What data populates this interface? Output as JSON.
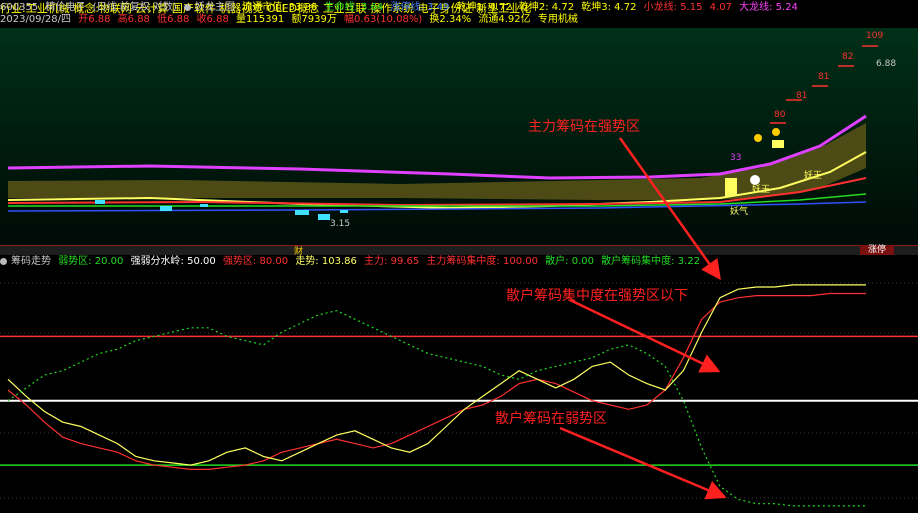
{
  "header": {
    "code": "600355",
    "name": "精伦电子",
    "period": "(日线 前复权 对数)",
    "main_label": "妖龙主图",
    "float_value": "流通市值: 33.86",
    "life_line": "生命线: 3.64",
    "cumulative": "涨停线: 3.49",
    "qk1": "乾坤1: 4.72",
    "qk2": "乾坤2: 4.72",
    "qk3": "乾坤3: 4.72",
    "small_dragon": "小龙线: 5.15",
    "mid": "4.07",
    "big_dragon": "大龙线: 5.24"
  },
  "quote": {
    "date": "2023/09/28/四",
    "open": "开6.88",
    "high": "高6.88",
    "low": "低6.88",
    "close": "收6.88",
    "volume": "量115391",
    "amount": "额7939万",
    "change": "幅0.63(10.08%)",
    "turnover": "换2.34%",
    "float": "流通4.92亿",
    "industry": "专用机械"
  },
  "concepts": "行业:工业机械 概念:物联网 云计算 国产软件 机器视觉 OLED概念 工业互联 操作系统 电子身份证 新型工业化",
  "upper_chart": {
    "price_labels": [
      "109",
      "82",
      "81",
      "81",
      "80"
    ],
    "last_price": "6.88",
    "low_price": "3.15",
    "bottom_label": "妖气",
    "text_wang": "妖王",
    "text_jingwang": "妖王",
    "text_33": "33",
    "fin_mark": "财",
    "zt_badge": "涨停"
  },
  "indicator": {
    "name": "筹码走势",
    "weak": "弱势区: 20.00",
    "divide": "强弱分水岭: 50.00",
    "strong": "强势区: 80.00",
    "trend": "走势: 103.86",
    "main": "主力: 99.65",
    "main_conc": "主力筹码集中度: 100.00",
    "retail": "散户: 0.00",
    "retail_conc": "散户筹码集中度: 3.22"
  },
  "annotations": {
    "a1": "主力筹码在强势区",
    "a2": "散户筹码集中度在强势区以下",
    "a3": "散户筹码在弱势区"
  },
  "colors": {
    "red": "#ff3030",
    "yellow": "#ffff60",
    "green": "#22dd22",
    "white": "#ffffff",
    "magenta": "#e040ff",
    "cyan": "#40e0ff"
  },
  "chart_data": {
    "type": "line",
    "title": "筹码走势",
    "ylim": [
      0,
      110
    ],
    "levels": [
      20,
      50,
      80
    ],
    "series": [
      {
        "name": "主力",
        "values": [
          55,
          48,
          40,
          33,
          30,
          28,
          26,
          22,
          20,
          19,
          18,
          18,
          19,
          20,
          22,
          26,
          28,
          30,
          32,
          30,
          28,
          30,
          34,
          38,
          42,
          46,
          48,
          52,
          58,
          60,
          58,
          54,
          50,
          48,
          46,
          48,
          55,
          70,
          88,
          96,
          98,
          99,
          99,
          99,
          99,
          100,
          100,
          100
        ]
      },
      {
        "name": "走势",
        "values": [
          60,
          52,
          45,
          40,
          38,
          34,
          30,
          24,
          22,
          21,
          20,
          22,
          26,
          28,
          24,
          22,
          26,
          30,
          34,
          36,
          32,
          28,
          26,
          30,
          38,
          46,
          52,
          58,
          64,
          60,
          56,
          60,
          66,
          68,
          62,
          58,
          55,
          64,
          82,
          98,
          102,
          103,
          103,
          104,
          104,
          104,
          104,
          104
        ]
      },
      {
        "name": "散户",
        "values": [
          50,
          56,
          62,
          64,
          68,
          72,
          74,
          78,
          80,
          82,
          84,
          84,
          80,
          78,
          76,
          82,
          86,
          90,
          92,
          88,
          84,
          80,
          76,
          72,
          70,
          68,
          66,
          62,
          60,
          64,
          66,
          68,
          70,
          74,
          76,
          72,
          66,
          50,
          28,
          10,
          4,
          2,
          2,
          1,
          1,
          1,
          1,
          1
        ]
      }
    ]
  }
}
